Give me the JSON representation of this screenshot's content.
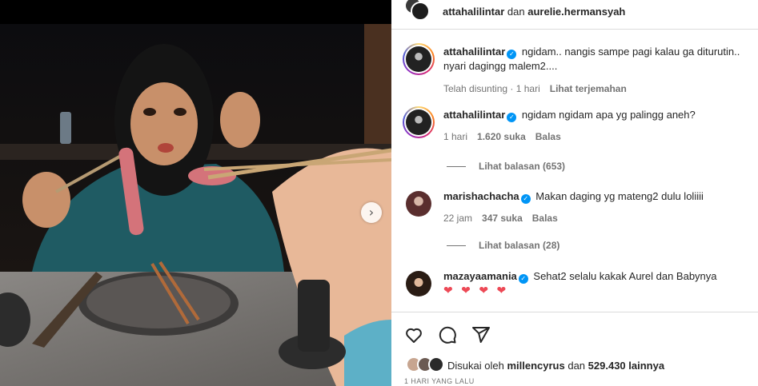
{
  "header": {
    "user1": "attahalilintar",
    "connector": "dan",
    "user2": "aurelie.hermansyah"
  },
  "comments": [
    {
      "username": "attahalilintar",
      "text": "ngidam.. nangis sampe pagi kalau ga diturutin.. nyari dagingg malem2....",
      "edited": "Telah disunting",
      "time": "1 hari",
      "translate": "Lihat terjemahan"
    },
    {
      "username": "attahalilintar",
      "text": "ngidam ngidam apa yg palingg aneh?",
      "time": "1 hari",
      "likes": "1.620 suka",
      "reply": "Balas",
      "view_replies": "Lihat balasan (653)"
    },
    {
      "username": "marishachacha",
      "text": "Makan daging yg mateng2 dulu loliiii",
      "time": "22 jam",
      "likes": "347 suka",
      "reply": "Balas",
      "view_replies": "Lihat balasan (28)"
    },
    {
      "username": "mazayaamania",
      "text": "Sehat2 selalu kakak Aurel dan Babynya",
      "hearts": "❤ ❤ ❤ ❤"
    }
  ],
  "liked_by": {
    "prefix": "Disukai oleh",
    "user": "millencyrus",
    "connector": "dan",
    "count": "529.430 lainnya"
  },
  "time_ago": "1 HARI YANG LALU",
  "icons": {
    "like": "heart-icon",
    "comment": "comment-icon",
    "share": "share-icon",
    "next": "chevron-right-icon",
    "verified": "verified-badge-icon"
  },
  "colors": {
    "verified": "#0095f6",
    "heart": "#ed4956",
    "muted": "#737373"
  }
}
